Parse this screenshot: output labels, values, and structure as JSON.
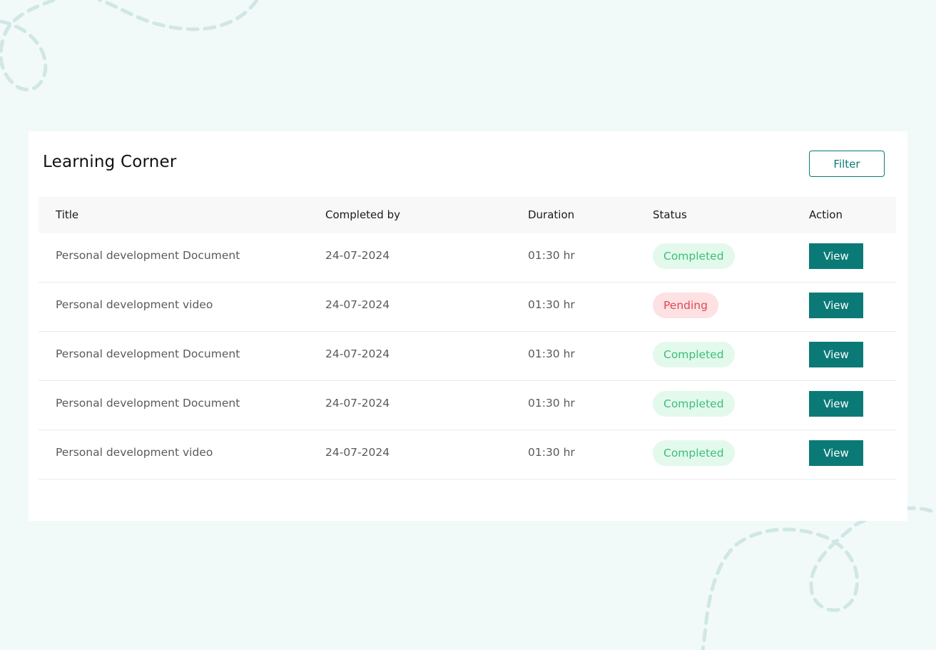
{
  "page": {
    "title": "Learning Corner",
    "filter_label": "Filter"
  },
  "table": {
    "headers": {
      "title": "Title",
      "completed_by": "Completed by",
      "duration": "Duration",
      "status": "Status",
      "action": "Action"
    },
    "rows": [
      {
        "title": "Personal development Document",
        "completed_by": "24-07-2024",
        "duration": "01:30 hr",
        "status": "Completed",
        "action": "View"
      },
      {
        "title": "Personal development video",
        "completed_by": "24-07-2024",
        "duration": "01:30 hr",
        "status": "Pending",
        "action": "View"
      },
      {
        "title": "Personal development Document",
        "completed_by": "24-07-2024",
        "duration": "01:30 hr",
        "status": "Completed",
        "action": "View"
      },
      {
        "title": "Personal development Document",
        "completed_by": "24-07-2024",
        "duration": "01:30 hr",
        "status": "Completed",
        "action": "View"
      },
      {
        "title": "Personal development video",
        "completed_by": "24-07-2024",
        "duration": "01:30 hr",
        "status": "Completed",
        "action": "View"
      }
    ]
  },
  "colors": {
    "accent": "#0b7a77",
    "background": "#f2f9f9",
    "completed_bg": "#e3f9ec",
    "completed_text": "#3bbf7a",
    "pending_bg": "#fde1e3",
    "pending_text": "#e04853",
    "decoration": "#cde6e4"
  }
}
